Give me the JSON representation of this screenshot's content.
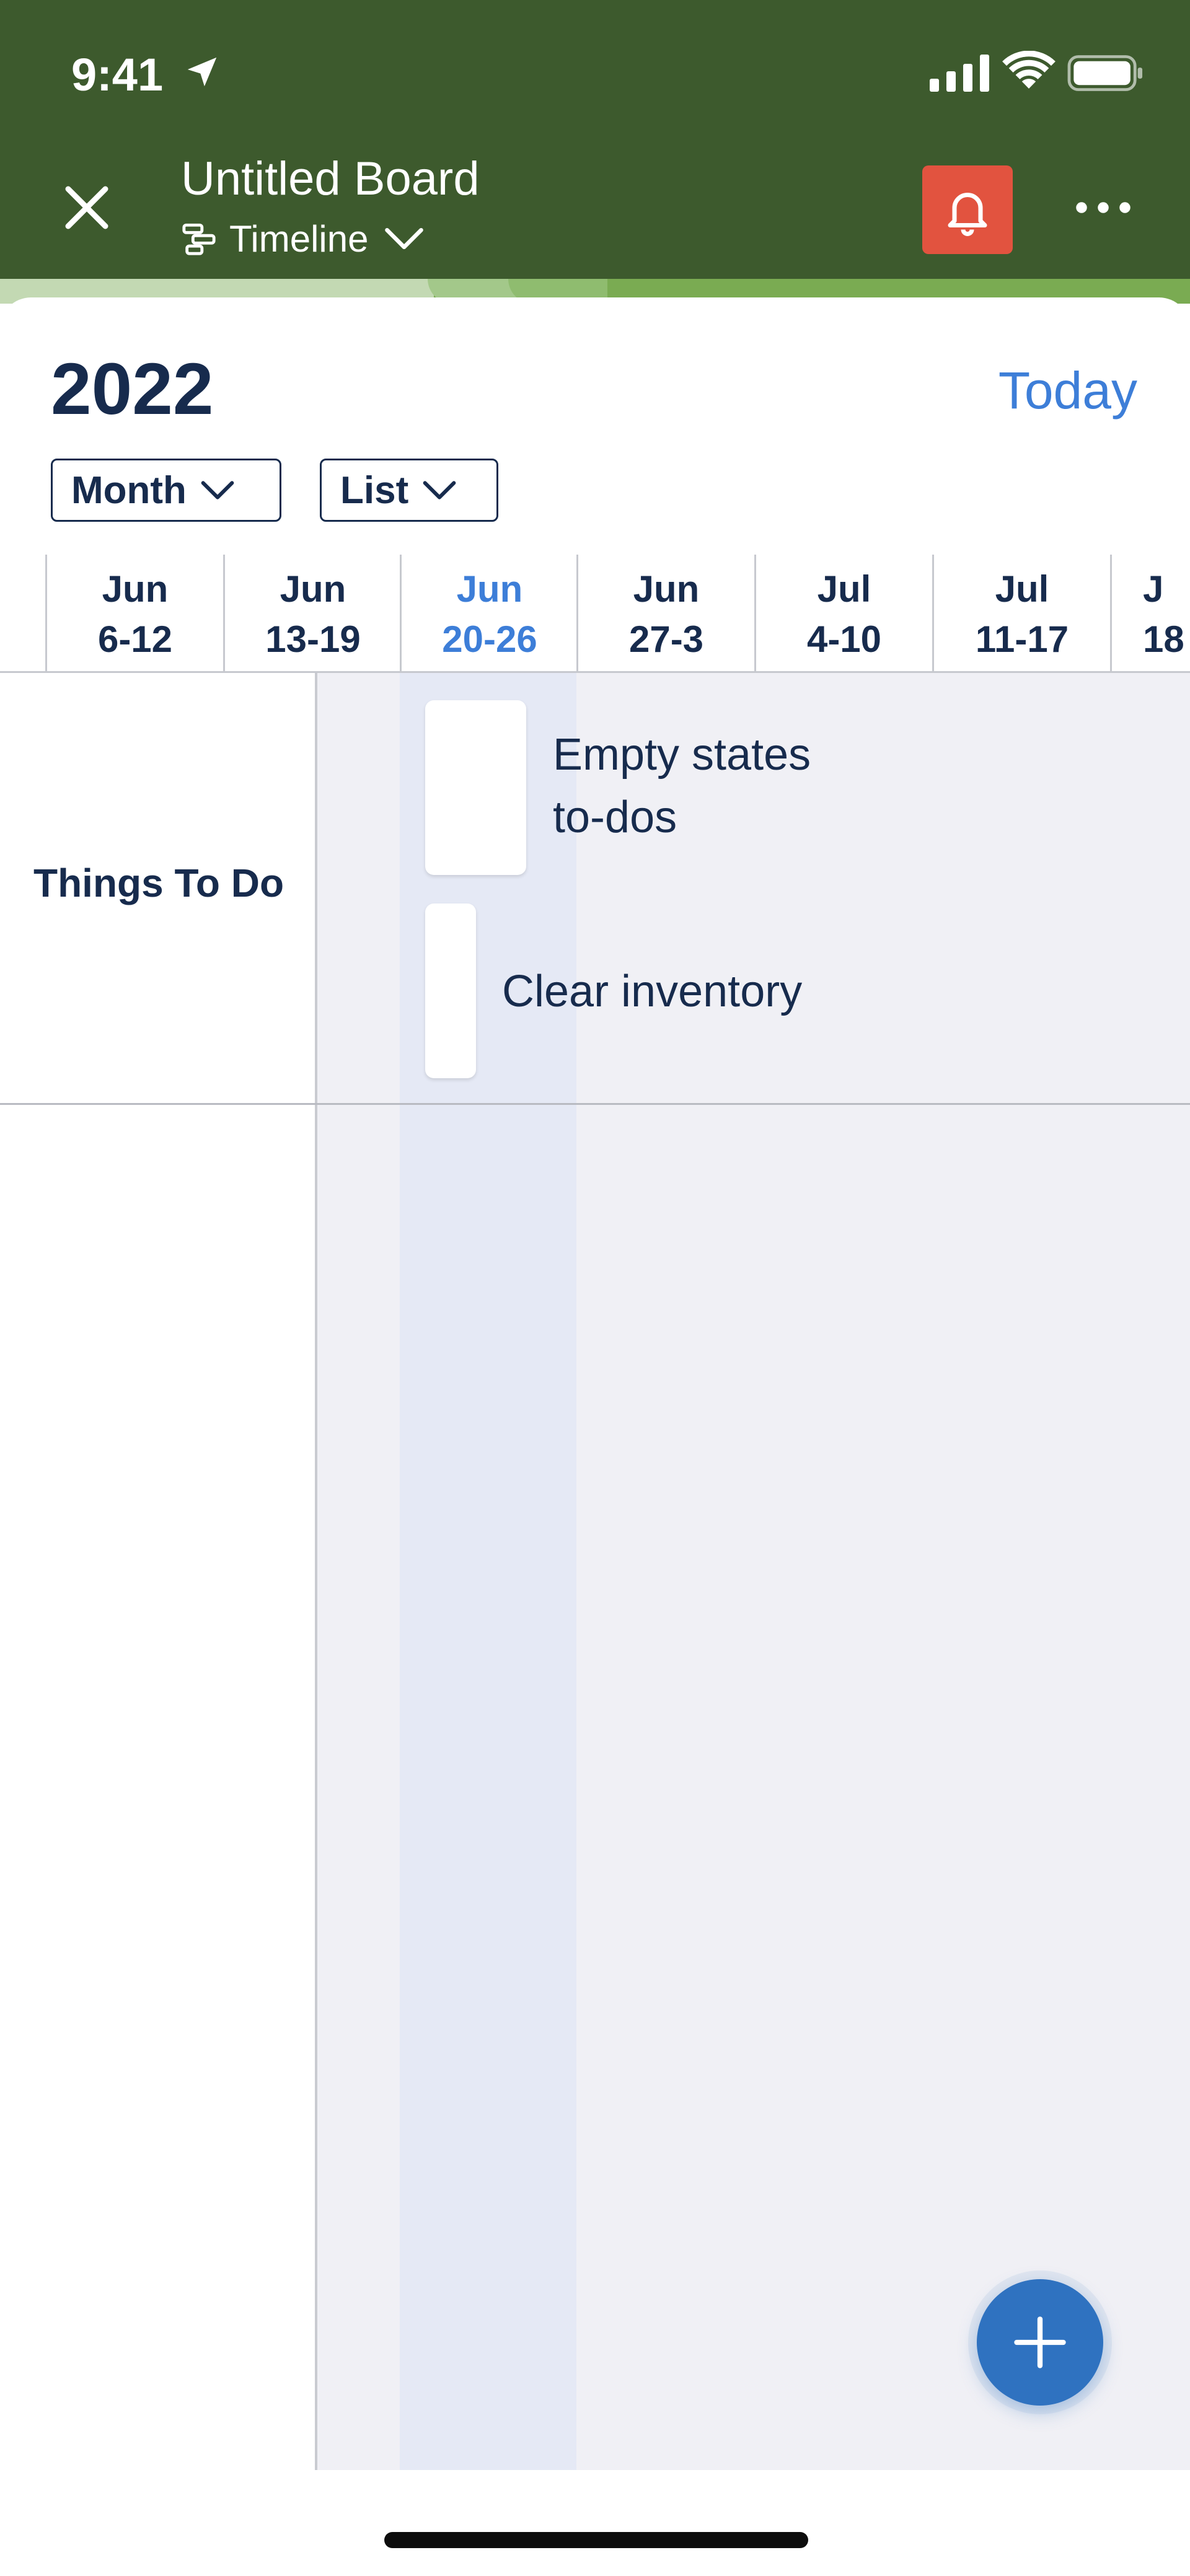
{
  "status_bar": {
    "time": "9:41",
    "icons": [
      "location-arrow-icon",
      "signal-icon",
      "wifi-icon",
      "battery-icon"
    ]
  },
  "header": {
    "title": "Untitled Board",
    "view_label": "Timeline",
    "icons": [
      "close-icon",
      "timeline-icon",
      "chevron-down-icon",
      "bell-icon",
      "more-icon"
    ],
    "colors": {
      "background": "#3d5a2d",
      "accent_strip": "#7aab52",
      "bell_button": "#e2533f"
    }
  },
  "toolbar": {
    "year": "2022",
    "today_label": "Today",
    "zoom_dropdown": "Month",
    "group_dropdown": "List"
  },
  "weeks": [
    {
      "month": "Jun",
      "range": "6-12"
    },
    {
      "month": "Jun",
      "range": "13-19"
    },
    {
      "month": "Jun",
      "range": "20-26",
      "current": true
    },
    {
      "month": "Jun",
      "range": "27-3"
    },
    {
      "month": "Jul",
      "range": "4-10"
    },
    {
      "month": "Jul",
      "range": "11-17"
    },
    {
      "month": "J",
      "range": "18"
    }
  ],
  "groups": [
    {
      "label": "Things To Do",
      "tasks": [
        {
          "title_line1": "Empty states",
          "title_line2": "to-dos"
        },
        {
          "title": "Clear inventory"
        }
      ]
    }
  ],
  "fab": {
    "icon": "plus-icon"
  },
  "colors": {
    "accent": "#3d7ed8",
    "text": "#172b4d",
    "fab": "#2f72c0"
  }
}
